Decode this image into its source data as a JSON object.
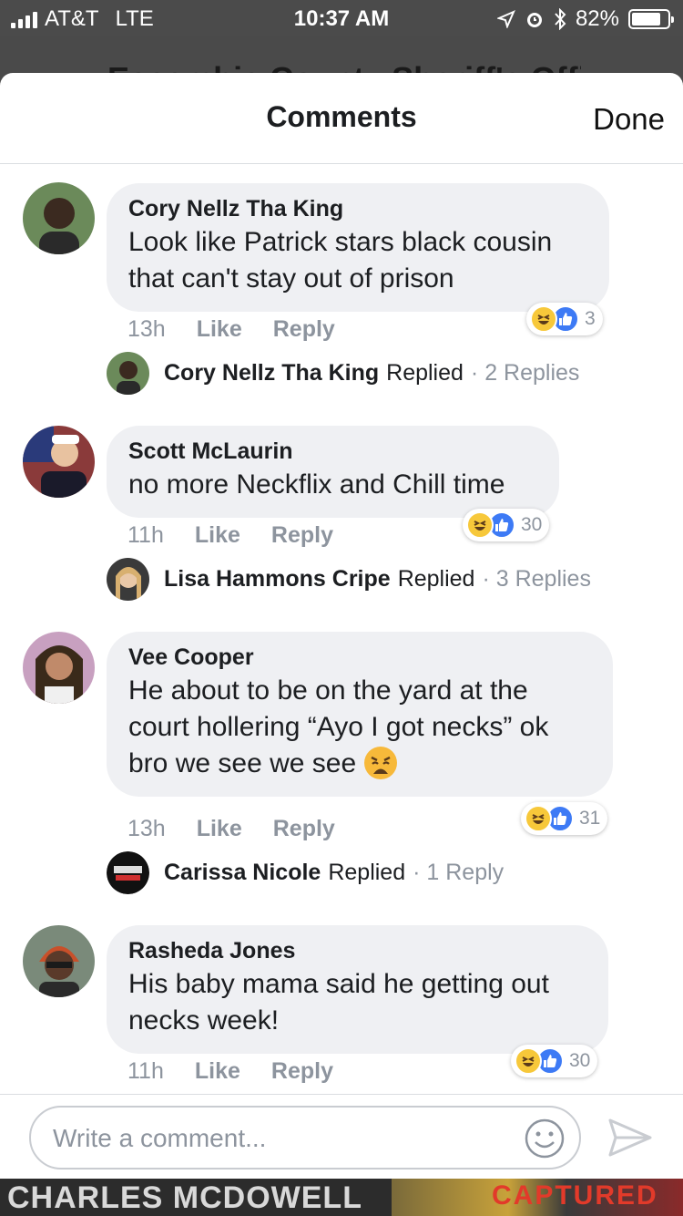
{
  "status_bar": {
    "carrier": "AT&T",
    "network": "LTE",
    "time": "10:37 AM",
    "battery": "82%",
    "battery_level": 0.82
  },
  "background_page": {
    "title": "Escambia County Sheriff's Offic"
  },
  "header": {
    "title": "Comments",
    "done_label": "Done"
  },
  "comments": [
    {
      "author": "Cory Nellz Tha King",
      "text": "Look like Patrick stars black cousin that can't stay out of prison",
      "time": "13h",
      "like_label": "Like",
      "reply_label": "Reply",
      "reaction_count": "3",
      "reply_author": "Cory Nellz Tha King",
      "replied_label": "Replied",
      "reply_count": "· 2 Replies"
    },
    {
      "author": "Scott McLaurin",
      "text": "no more Neckflix and Chill time",
      "time": "11h",
      "like_label": "Like",
      "reply_label": "Reply",
      "reaction_count": "30",
      "reply_author": "Lisa Hammons Cripe",
      "replied_label": "Replied",
      "reply_count": "· 3 Replies"
    },
    {
      "author": "Vee Cooper",
      "text": "He about to be on the yard at the court hollering “Ayo I got necks” ok bro we see we see",
      "emoji": "weary-face-emoji",
      "time": "13h",
      "like_label": "Like",
      "reply_label": "Reply",
      "reaction_count": "31",
      "reply_author": "Carissa Nicole",
      "replied_label": "Replied",
      "reply_count": "· 1 Reply"
    },
    {
      "author": "Rasheda Jones",
      "text": "His baby mama said he getting out necks week!",
      "time": "11h",
      "like_label": "Like",
      "reply_label": "Reply",
      "reaction_count": "30"
    }
  ],
  "composer": {
    "placeholder": "Write a comment...",
    "emoji_icon": "smiley-icon",
    "send_icon": "send-icon"
  },
  "background_bottom": {
    "text": "CHARLES MCDOWELL",
    "banner": "CAPTURED"
  },
  "colors": {
    "bubble": "#eff0f3",
    "like_blue": "#3d7af5",
    "haha_yellow": "#f7c83a",
    "meta_gray": "#8d949e"
  }
}
